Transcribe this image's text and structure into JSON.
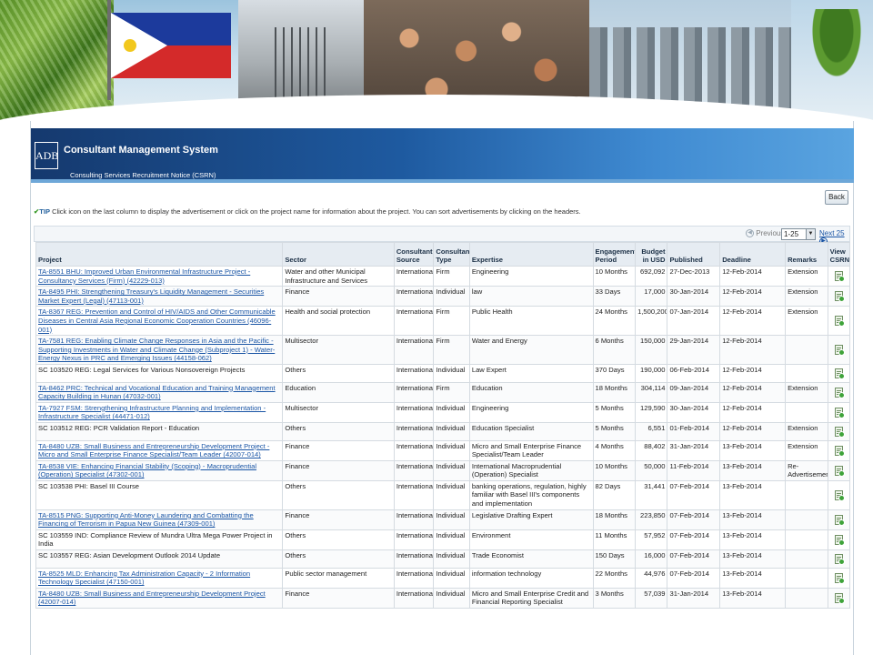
{
  "banner": {
    "icons": [
      "philippine-flag",
      "palm-leaves",
      "railway-photo",
      "crowd-photo",
      "city-skyline-photo"
    ]
  },
  "app": {
    "logo": "ADB",
    "title": "Consultant Management System",
    "subtitle": "Consulting Services Recruitment Notice (CSRN)",
    "back_label": "Back",
    "tip_label": "TIP",
    "tip_text": "Click icon on the last column to display the advertisement or click on the project name for information about the project. You can sort advertisements by clicking on the headers."
  },
  "pager": {
    "previous_label": "Previous",
    "range_value": "1-25",
    "next_label": "Next 25"
  },
  "table": {
    "headers": {
      "project": "Project",
      "sector": "Sector",
      "source": "Consultant Source",
      "type": "Consultant Type",
      "expertise": "Expertise",
      "period": "Engagement Period",
      "budget": "Budget in USD",
      "published": "Published",
      "deadline": "Deadline",
      "remarks": "Remarks",
      "view": "View CSRN"
    },
    "rows": [
      {
        "project": "TA-8551 BHU: Improved Urban Environmental Infrastructure Project - Consultancy Services (Firm) (42229-013)",
        "link": true,
        "sector": "Water and other Municipal Infrastructure and Services",
        "source": "International",
        "type": "Firm",
        "expertise": "Engineering",
        "period": "10 Months",
        "budget": "692,092",
        "published": "27-Dec-2013",
        "deadline": "12-Feb-2014",
        "remarks": "Extension"
      },
      {
        "project": "TA-8495 PHI: Strengthening Treasury's Liquidity Management - Securities Market Expert (Legal) (47113-001)",
        "link": true,
        "sector": "Finance",
        "source": "International",
        "type": "Individual",
        "expertise": "law",
        "period": "33 Days",
        "budget": "17,000",
        "published": "30-Jan-2014",
        "deadline": "12-Feb-2014",
        "remarks": "Extension"
      },
      {
        "project": "TA-8367 REG: Prevention and Control of HIV/AIDS and Other Communicable Diseases in Central Asia Regional Economic Cooperation Countries (46096-001)",
        "link": true,
        "sector": "Health and social protection",
        "source": "International",
        "type": "Firm",
        "expertise": "Public Health",
        "period": "24 Months",
        "budget": "1,500,200",
        "published": "07-Jan-2014",
        "deadline": "12-Feb-2014",
        "remarks": "Extension"
      },
      {
        "project": "TA-7581 REG: Enabling Climate Change Responses in Asia and the Pacific - Supporting Investments in Water and Climate Change (Subproject 1) - Water-Energy Nexus in PRC and Emerging Issues (44158-062)",
        "link": true,
        "sector": "Multisector",
        "source": "International",
        "type": "Firm",
        "expertise": "Water and Energy",
        "period": "6 Months",
        "budget": "150,000",
        "published": "29-Jan-2014",
        "deadline": "12-Feb-2014",
        "remarks": ""
      },
      {
        "project": "SC 103520 REG: Legal Services for Various Nonsovereign Projects",
        "link": false,
        "sector": "Others",
        "source": "International",
        "type": "Individual",
        "expertise": "Law Expert",
        "period": "370 Days",
        "budget": "190,000",
        "published": "06-Feb-2014",
        "deadline": "12-Feb-2014",
        "remarks": ""
      },
      {
        "project": "TA-8462 PRC: Technical and Vocational Education and Training Management Capacity Building in Hunan (47032-001)",
        "link": true,
        "sector": "Education",
        "source": "International",
        "type": "Firm",
        "expertise": "Education",
        "period": "18 Months",
        "budget": "304,114",
        "published": "09-Jan-2014",
        "deadline": "12-Feb-2014",
        "remarks": "Extension"
      },
      {
        "project": "TA-7927 FSM: Strengthening Infrastructure Planning and Implementation - Infrastructure Specialist (44471-012)",
        "link": true,
        "sector": "Multisector",
        "source": "International",
        "type": "Individual",
        "expertise": "Engineering",
        "period": "5 Months",
        "budget": "129,590",
        "published": "30-Jan-2014",
        "deadline": "12-Feb-2014",
        "remarks": ""
      },
      {
        "project": "SC 103512 REG: PCR Validation Report - Education",
        "link": false,
        "sector": "Others",
        "source": "International",
        "type": "Individual",
        "expertise": "Education Specialist",
        "period": "5 Months",
        "budget": "6,551",
        "published": "01-Feb-2014",
        "deadline": "12-Feb-2014",
        "remarks": "Extension"
      },
      {
        "project": "TA-8480 UZB: Small Business and Entrepreneurship Development Project - Micro and Small Enterprise Finance Specialist/Team Leader (42007-014)",
        "link": true,
        "sector": "Finance",
        "source": "International",
        "type": "Individual",
        "expertise": "Micro and Small Enterprise Finance Specialist/Team Leader",
        "period": "4 Months",
        "budget": "88,402",
        "published": "31-Jan-2014",
        "deadline": "13-Feb-2014",
        "remarks": "Extension"
      },
      {
        "project": "TA-8538 VIE: Enhancing Financial Stability (Scoping) - Macroprudential (Operation) Specialist (47302-001)",
        "link": true,
        "sector": "Finance",
        "source": "International",
        "type": "Individual",
        "expertise": "International Macroprudential (Operation) Specialist",
        "period": "10 Months",
        "budget": "50,000",
        "published": "11-Feb-2014",
        "deadline": "13-Feb-2014",
        "remarks": "Re-Advertisement"
      },
      {
        "project": "SC 103538 PHI: Basel III Course",
        "link": false,
        "sector": "Others",
        "source": "International",
        "type": "Individual",
        "expertise": "banking operations, regulation, highly familiar with Basel III's components and implementation",
        "period": "82 Days",
        "budget": "31,441",
        "published": "07-Feb-2014",
        "deadline": "13-Feb-2014",
        "remarks": ""
      },
      {
        "project": "TA-8515 PNG: Supporting Anti-Money Laundering and Combatting the Financing of Terrorism in Papua New Guinea (47309-001)",
        "link": true,
        "sector": "Finance",
        "source": "International",
        "type": "Individual",
        "expertise": "Legislative Drafting Expert",
        "period": "18 Months",
        "budget": "223,850",
        "published": "07-Feb-2014",
        "deadline": "13-Feb-2014",
        "remarks": ""
      },
      {
        "project": "SC 103559 IND: Compliance Review of Mundra Ultra Mega Power Project in India",
        "link": false,
        "sector": "Others",
        "source": "International",
        "type": "Individual",
        "expertise": "Environment",
        "period": "11 Months",
        "budget": "57,952",
        "published": "07-Feb-2014",
        "deadline": "13-Feb-2014",
        "remarks": ""
      },
      {
        "project": "SC 103557 REG: Asian Development Outlook 2014 Update",
        "link": false,
        "sector": "Others",
        "source": "International",
        "type": "Individual",
        "expertise": "Trade Economist",
        "period": "150 Days",
        "budget": "16,000",
        "published": "07-Feb-2014",
        "deadline": "13-Feb-2014",
        "remarks": ""
      },
      {
        "project": "TA-8525 MLD: Enhancing Tax Administration Capacity - 2 Information Technology Specialist (47150-001)",
        "link": true,
        "sector": "Public sector management",
        "source": "International",
        "type": "Individual",
        "expertise": "information technology",
        "period": "22 Months",
        "budget": "44,976",
        "published": "07-Feb-2014",
        "deadline": "13-Feb-2014",
        "remarks": ""
      },
      {
        "project": "TA-8480 UZB: Small Business and Entrepreneurship Development Project (42007-014)",
        "link": true,
        "sector": "Finance",
        "source": "International",
        "type": "Individual",
        "expertise": "Micro and Small Enterprise Credit and Financial Reporting Specialist",
        "period": "3 Months",
        "budget": "57,039",
        "published": "31-Jan-2014",
        "deadline": "13-Feb-2014",
        "remarks": ""
      }
    ]
  }
}
